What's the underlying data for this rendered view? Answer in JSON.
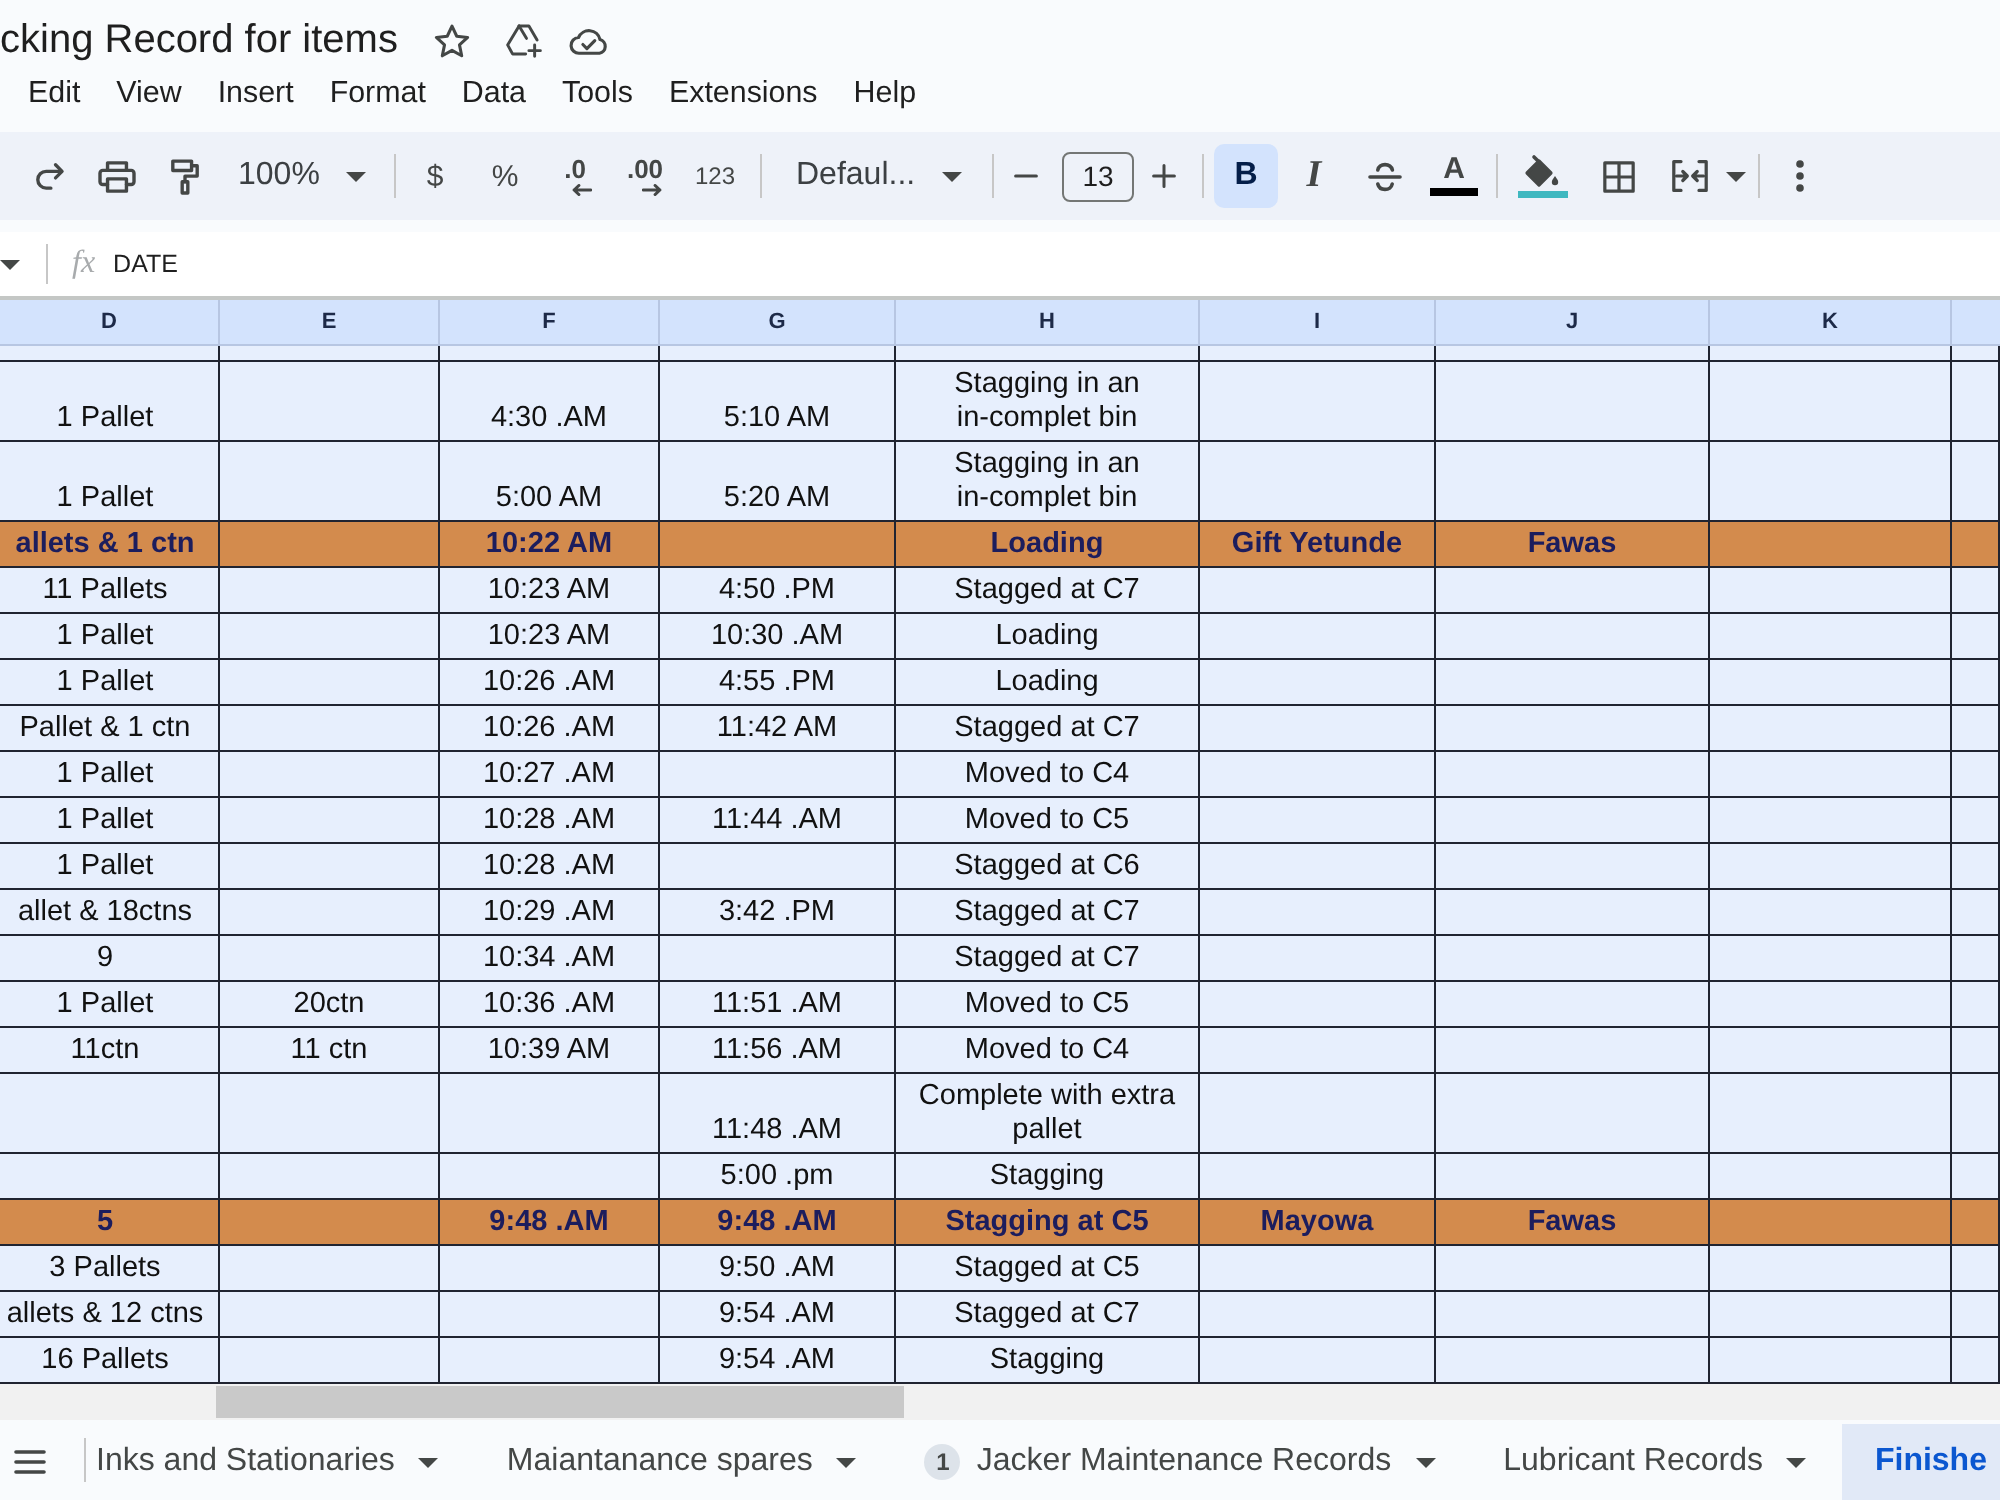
{
  "document": {
    "title": "cking Record for items"
  },
  "menu": [
    "Edit",
    "View",
    "Insert",
    "Format",
    "Data",
    "Tools",
    "Extensions",
    "Help"
  ],
  "toolbar": {
    "zoom": "100%",
    "currency": "$",
    "percent": "%",
    "decrease_decimals": ".0",
    "increase_decimals": ".00",
    "number_format": "123",
    "font": "Defaul...",
    "font_size": "13",
    "styles": [
      {
        "kind": "bold",
        "label": "B",
        "selected": true
      },
      {
        "kind": "italic",
        "label": "I",
        "selected": false
      },
      {
        "kind": "strikethrough",
        "selected": false
      }
    ],
    "text_color": "A"
  },
  "formula_bar": {
    "label": "fx",
    "value": "DATE"
  },
  "sheet": {
    "columns": [
      "D",
      "E",
      "F",
      "G",
      "H",
      "I",
      "J",
      "K"
    ],
    "rows": [
      {
        "kind": "entry",
        "cells": [
          "1 Pallet",
          null,
          "4:30 .AM",
          "5:10 AM",
          "Stagging in an in-complet bin"
        ]
      },
      {
        "kind": "entry",
        "cells": [
          "1 Pallet",
          null,
          "5:00 AM",
          "5:20 AM",
          "Stagging in an in-complet bin"
        ]
      },
      {
        "kind": "highlight",
        "cells": [
          "allets & 1 ctn",
          null,
          "10:22 AM",
          null,
          "Loading",
          "Gift Yetunde",
          "Fawas"
        ]
      },
      {
        "kind": "entry",
        "cells": [
          "11 Pallets",
          null,
          "10:23 AM",
          "4:50 .PM",
          "Stagged at C7"
        ]
      },
      {
        "kind": "entry",
        "cells": [
          "1 Pallet",
          null,
          "10:23 AM",
          "10:30 .AM",
          "Loading"
        ]
      },
      {
        "kind": "entry",
        "cells": [
          "1 Pallet",
          null,
          "10:26 .AM",
          "4:55 .PM",
          "Loading"
        ]
      },
      {
        "kind": "entry",
        "cells": [
          "Pallet & 1 ctn",
          null,
          "10:26 .AM",
          "11:42 AM",
          "Stagged at C7"
        ]
      },
      {
        "kind": "entry",
        "cells": [
          "1 Pallet",
          null,
          "10:27 .AM",
          null,
          "Moved to C4"
        ]
      },
      {
        "kind": "entry",
        "cells": [
          "1 Pallet",
          null,
          "10:28 .AM",
          "11:44 .AM",
          "Moved to C5"
        ]
      },
      {
        "kind": "entry",
        "cells": [
          "1 Pallet",
          null,
          "10:28 .AM",
          null,
          "Stagged at C6"
        ]
      },
      {
        "kind": "entry",
        "cells": [
          "allet & 18ctns",
          null,
          "10:29 .AM",
          "3:42 .PM",
          "Stagged at C7"
        ]
      },
      {
        "kind": "entry",
        "cells": [
          "9",
          null,
          "10:34 .AM",
          null,
          "Stagged at C7"
        ]
      },
      {
        "kind": "entry",
        "cells": [
          "1 Pallet",
          "20ctn",
          "10:36 .AM",
          "11:51 .AM",
          "Moved to C5"
        ]
      },
      {
        "kind": "entry",
        "cells": [
          "11ctn",
          "11 ctn",
          "10:39 AM",
          "11:56 .AM",
          "Moved to C4"
        ]
      },
      {
        "kind": "entry",
        "cells": [
          null,
          null,
          null,
          "11:48 .AM",
          "Complete with extra pallet"
        ]
      },
      {
        "kind": "entry",
        "cells": [
          null,
          null,
          null,
          "5:00 .pm",
          "Stagging"
        ]
      },
      {
        "kind": "highlight",
        "cells": [
          "5",
          null,
          "9:48 .AM",
          "9:48 .AM",
          "Stagging at C5",
          "Mayowa",
          "Fawas"
        ]
      },
      {
        "kind": "entry",
        "cells": [
          "3 Pallets",
          null,
          null,
          "9:50 .AM",
          "Stagged at C5"
        ]
      },
      {
        "kind": "entry",
        "cells": [
          "allets & 12 ctns",
          null,
          null,
          "9:54 .AM",
          "Stagged at C7"
        ]
      },
      {
        "kind": "entry",
        "cells": [
          "16 Pallets",
          null,
          null,
          "9:54 .AM",
          "Stagging"
        ]
      }
    ]
  },
  "sheet_tabs": [
    {
      "label": "Inks and Stationaries",
      "menu": true,
      "selected": false
    },
    {
      "label": "Maiantanance spares",
      "menu": true,
      "selected": false
    },
    {
      "label": "Jacker Maintenance Records",
      "badge": "1",
      "menu": true,
      "selected": false
    },
    {
      "label": "Lubricant Records",
      "menu": true,
      "selected": false
    },
    {
      "label": "Finishe",
      "menu": false,
      "selected": true
    }
  ]
}
